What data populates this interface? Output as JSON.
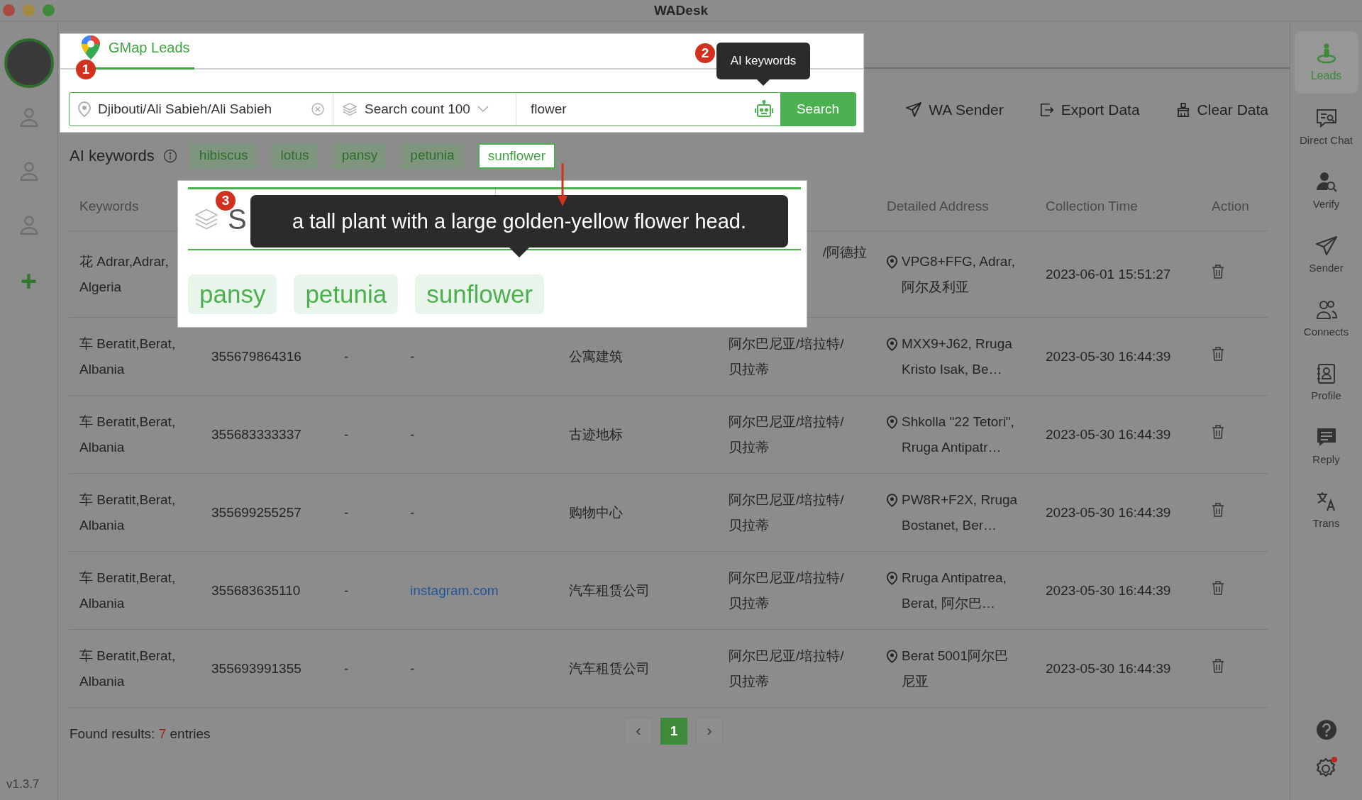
{
  "window": {
    "title": "WADesk"
  },
  "version": "v1.3.7",
  "add_account": "+",
  "tab": {
    "label": "GMap Leads",
    "selected": true,
    "callout": "1"
  },
  "search_bar": {
    "location": "Djibouti/Ali Sabieh/Ali Sabieh",
    "count": "Search count 100",
    "keyword": "flower",
    "button": "Search",
    "callout": "2",
    "tooltip": "AI keywords"
  },
  "actions": [
    {
      "label": "WA Sender",
      "kind": "send"
    },
    {
      "label": "Export Data",
      "kind": "export"
    },
    {
      "label": "Clear Data",
      "kind": "clear"
    }
  ],
  "ai_keywords": {
    "label": "AI keywords",
    "chips": [
      {
        "label": "hibiscus",
        "selected": false
      },
      {
        "label": "lotus",
        "selected": false
      },
      {
        "label": "pansy",
        "selected": false
      },
      {
        "label": "petunia",
        "selected": false
      },
      {
        "label": "sunflower",
        "selected": true
      }
    ]
  },
  "preview": {
    "callout": "3",
    "heading_fragment": "S",
    "tooltip": "a tall plant with a large golden-yellow flower head.",
    "chips": [
      "pansy",
      "petunia",
      "sunflower"
    ]
  },
  "table": {
    "columns": {
      "keywords": "Keywords",
      "detailed_address": "Detailed Address",
      "collection_time": "Collection Time",
      "action": "Action"
    },
    "rows": [
      {
        "covered": true,
        "keywords": "花 Adrar,Adrar, Algeria",
        "column_6": "/阿德拉",
        "detailed_address": "VPG8+FFG, Adrar, 阿尔及利亚",
        "collection_time": "2023-06-01 15:51:27"
      },
      {
        "covered": false,
        "link": false,
        "keywords": "车 Beratit,Berat, Albania",
        "column_2": "355679864316",
        "column_3": "-",
        "column_4": "-",
        "column_5": "公寓建筑",
        "column_6": "阿尔巴尼亚/培拉特/贝拉蒂",
        "detailed_address": "MXX9+J62, Rruga Kristo Isak, Be…",
        "collection_time": "2023-05-30 16:44:39"
      },
      {
        "covered": false,
        "link": false,
        "keywords": "车 Beratit,Berat, Albania",
        "column_2": "355683333337",
        "column_3": "-",
        "column_4": "-",
        "column_5": "古迹地标",
        "column_6": "阿尔巴尼亚/培拉特/贝拉蒂",
        "detailed_address": "Shkolla \"22 Tetori\", Rruga Antipatr…",
        "collection_time": "2023-05-30 16:44:39"
      },
      {
        "covered": false,
        "link": false,
        "keywords": "车 Beratit,Berat, Albania",
        "column_2": "355699255257",
        "column_3": "-",
        "column_4": "-",
        "column_5": "购物中心",
        "column_6": "阿尔巴尼亚/培拉特/贝拉蒂",
        "detailed_address": "PW8R+F2X, Rruga Bostanet, Ber…",
        "collection_time": "2023-05-30 16:44:39"
      },
      {
        "covered": false,
        "link": true,
        "keywords": "车 Beratit,Berat, Albania",
        "column_2": "355683635110",
        "column_3": "-",
        "column_4": "instagram.com",
        "column_5": "汽车租赁公司",
        "column_6": "阿尔巴尼亚/培拉特/贝拉蒂",
        "detailed_address": "Rruga Antipatrea, Berat, 阿尔巴…",
        "collection_time": "2023-05-30 16:44:39"
      },
      {
        "covered": false,
        "link": false,
        "keywords": "车 Beratit,Berat, Albania",
        "column_2": "355693991355",
        "column_3": "-",
        "column_4": "-",
        "column_5": "汽车租赁公司",
        "column_6": "阿尔巴尼亚/培拉特/贝拉蒂",
        "detailed_address": "Berat 5001阿尔巴尼亚",
        "collection_time": "2023-05-30 16:44:39"
      }
    ]
  },
  "footer": {
    "results_label": "Found results:",
    "results_count": "7",
    "results_suffix": "entries",
    "prev": "‹",
    "next": "›",
    "pages": [
      {
        "label": "1",
        "selected": true
      }
    ]
  },
  "right_sidebar": [
    {
      "label": "Leads",
      "kind": "leads",
      "selected": true
    },
    {
      "label": "Direct Chat",
      "kind": "chat",
      "selected": false
    },
    {
      "label": "Verify",
      "kind": "verify",
      "selected": false
    },
    {
      "label": "Sender",
      "kind": "sender",
      "selected": false
    },
    {
      "label": "Connects",
      "kind": "connects",
      "selected": false
    },
    {
      "label": "Profile",
      "kind": "profile",
      "selected": false
    },
    {
      "label": "Reply",
      "kind": "reply",
      "selected": false
    },
    {
      "label": "Trans",
      "kind": "trans",
      "selected": false
    }
  ]
}
